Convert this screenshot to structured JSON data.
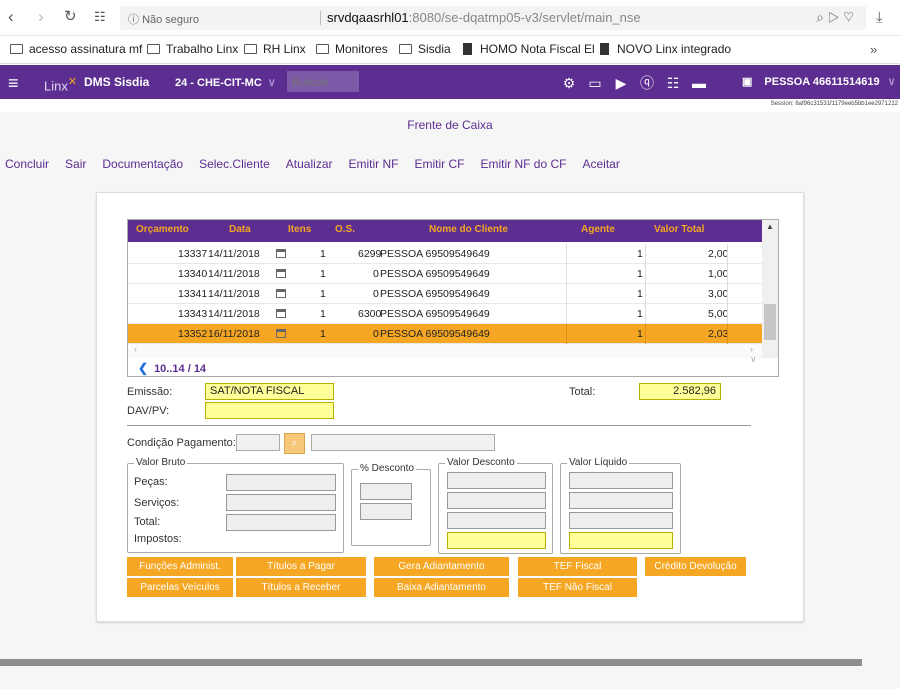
{
  "browser": {
    "secure_label": "Não seguro",
    "url_host": "srvdqaasrhl01",
    "url_rest": ":8080/se-dqatmp05-v3/servlet/main_nse",
    "bookmarks": [
      {
        "label": "acesso assinatura mf"
      },
      {
        "label": "Trabalho Linx"
      },
      {
        "label": "RH Linx"
      },
      {
        "label": "Monitores"
      },
      {
        "label": "Sisdia"
      },
      {
        "label": "HOMO Nota Fiscal El"
      },
      {
        "label": "NOVO Linx integrado"
      }
    ],
    "more": "»"
  },
  "app": {
    "logo": "Linx",
    "name": "DMS Sisdia",
    "branch": "24 - CHE-CIT-MC",
    "search_placeholder": "Buscar",
    "user": "PESSOA 46611514619",
    "session": "Session: 6af96c31531f1179eeb5bb1ee2971212"
  },
  "page": {
    "title": "Frente de Caixa",
    "toolbar": [
      "Concluir",
      "Sair",
      "Documentação",
      "Selec.Cliente",
      "Atualizar",
      "Emitir NF",
      "Emitir CF",
      "Emitir NF do CF",
      "Aceitar"
    ]
  },
  "grid": {
    "columns": [
      "Orçamento",
      "Data",
      "Itens",
      "O.S.",
      "Nome do Cliente",
      "Agente",
      "Valor Total"
    ],
    "rows": [
      {
        "orc": "13337",
        "data": "14/11/2018",
        "itens": "1",
        "os": "6299",
        "cliente": "PESSOA 69509549649",
        "agente": "1",
        "valor": "2,00"
      },
      {
        "orc": "13340",
        "data": "14/11/2018",
        "itens": "1",
        "os": "0",
        "cliente": "PESSOA 69509549649",
        "agente": "1",
        "valor": "1,00"
      },
      {
        "orc": "13341",
        "data": "14/11/2018",
        "itens": "1",
        "os": "0",
        "cliente": "PESSOA 69509549649",
        "agente": "1",
        "valor": "3,00"
      },
      {
        "orc": "13343",
        "data": "14/11/2018",
        "itens": "1",
        "os": "6300",
        "cliente": "PESSOA 69509549649",
        "agente": "1",
        "valor": "5,00"
      },
      {
        "orc": "13352",
        "data": "16/11/2018",
        "itens": "1",
        "os": "0",
        "cliente": "PESSOA 69509549649",
        "agente": "1",
        "valor": "2,03"
      }
    ],
    "pager": "10..14 / 14"
  },
  "form": {
    "emissao_label": "Emissão:",
    "emissao_value": "SAT/NOTA FISCAL",
    "dav_label": "DAV/PV:",
    "dav_value": "",
    "total_label": "Total:",
    "total_value": "2.582,96",
    "condicao_label": "Condição Pagamento:",
    "valor_bruto": "Valor Bruto",
    "pecas": "Peças:",
    "servicos": "Serviços:",
    "total2": "Total:",
    "impostos": "Impostos:",
    "pct_desconto": "% Desconto",
    "valor_desconto": "Valor Desconto",
    "valor_liquido": "Valor Líquido"
  },
  "buttons": {
    "row1": [
      "Funções Administ.",
      "Títulos a Pagar",
      "Gera Adiantamento",
      "TEF Fiscal",
      "Crédito Devolução"
    ],
    "row2": [
      "Parcelas Veículos",
      "Títulos a Receber",
      "Baixa Adiantamento",
      "TEF Não Fiscal"
    ]
  }
}
